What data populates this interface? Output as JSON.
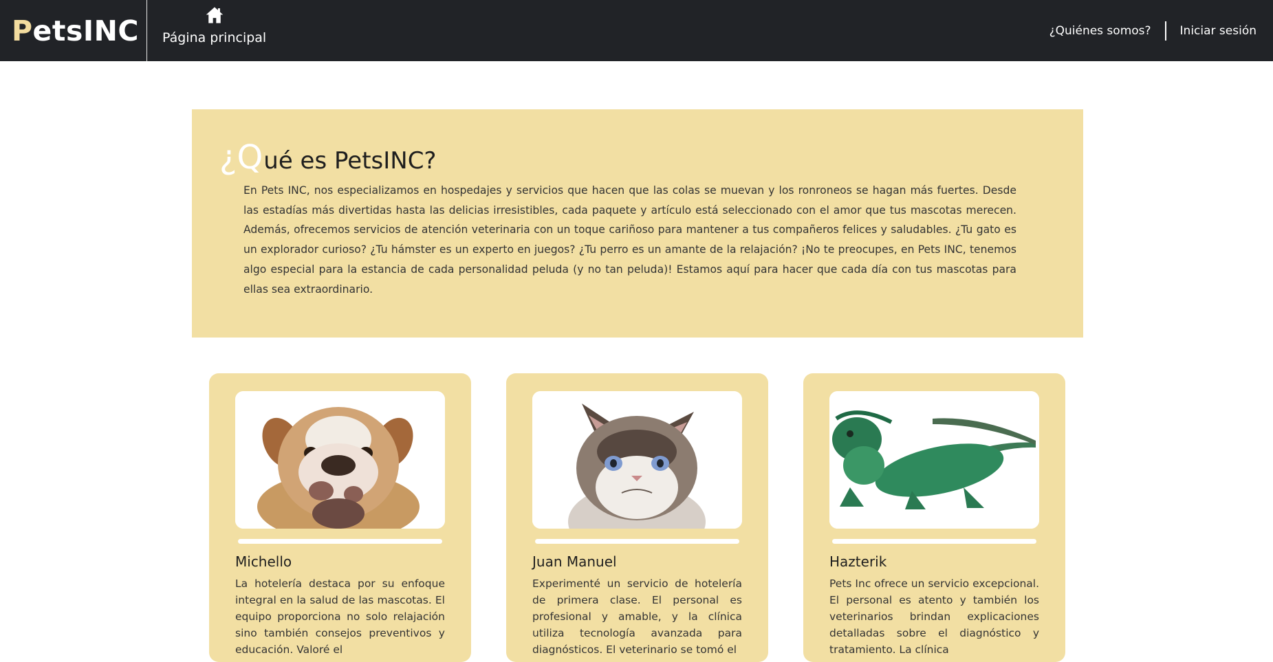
{
  "header": {
    "brand_first": "P",
    "brand_rest": "etsINC",
    "home_label": "Página principal",
    "home_icon": "house-icon",
    "nav": [
      {
        "label": "¿Quiénes somos?"
      },
      {
        "label": "Iniciar sesión"
      }
    ]
  },
  "about": {
    "title_first": "¿Q",
    "title_rest": "ué es PetsINC?",
    "text": "En Pets INC, nos especializamos en hospedajes y servicios que hacen que las colas se muevan y los ronroneos se hagan más fuertes. Desde las estadías más divertidas hasta las delicias irresistibles, cada paquete y artículo está seleccionado con el amor que tus mascotas merecen. Además, ofrecemos servicios de atención veterinaria con un toque cariñoso para mantener a tus compañeros felices y saludables. ¿Tu gato es un explorador curioso? ¿Tu hámster es un experto en juegos? ¿Tu perro es un amante de la relajación? ¡No te preocupes, en Pets INC, tenemos algo especial para la estancia de cada personalidad peluda (y no tan peluda)! Estamos aquí para hacer que cada día con tus mascotas para ellas sea extraordinario."
  },
  "testimonials": [
    {
      "name": "Michello",
      "image": "bulldog-photo",
      "text": "La hotelería destaca por su enfoque integral en la salud de las mascotas. El equipo proporciona no solo relajación sino también consejos preventivos y educación. Valoré el"
    },
    {
      "name": "Juan Manuel",
      "image": "grumpy-cat-photo",
      "text": "Experimenté un servicio de hotelería de primera clase. El personal es profesional y amable, y la clínica utiliza tecnología avanzada para diagnósticos. El veterinario se tomó el"
    },
    {
      "name": "Hazterik",
      "image": "iguana-photo",
      "text": "Pets Inc ofrece un servicio excepcional. El personal es atento y también los veterinarios brindan explicaciones detalladas sobre el diagnóstico y tratamiento. La clínica"
    }
  ],
  "colors": {
    "header_bg": "#212327",
    "brand_accent": "#f3dc9f",
    "card_bg": "#f2dfa3"
  }
}
